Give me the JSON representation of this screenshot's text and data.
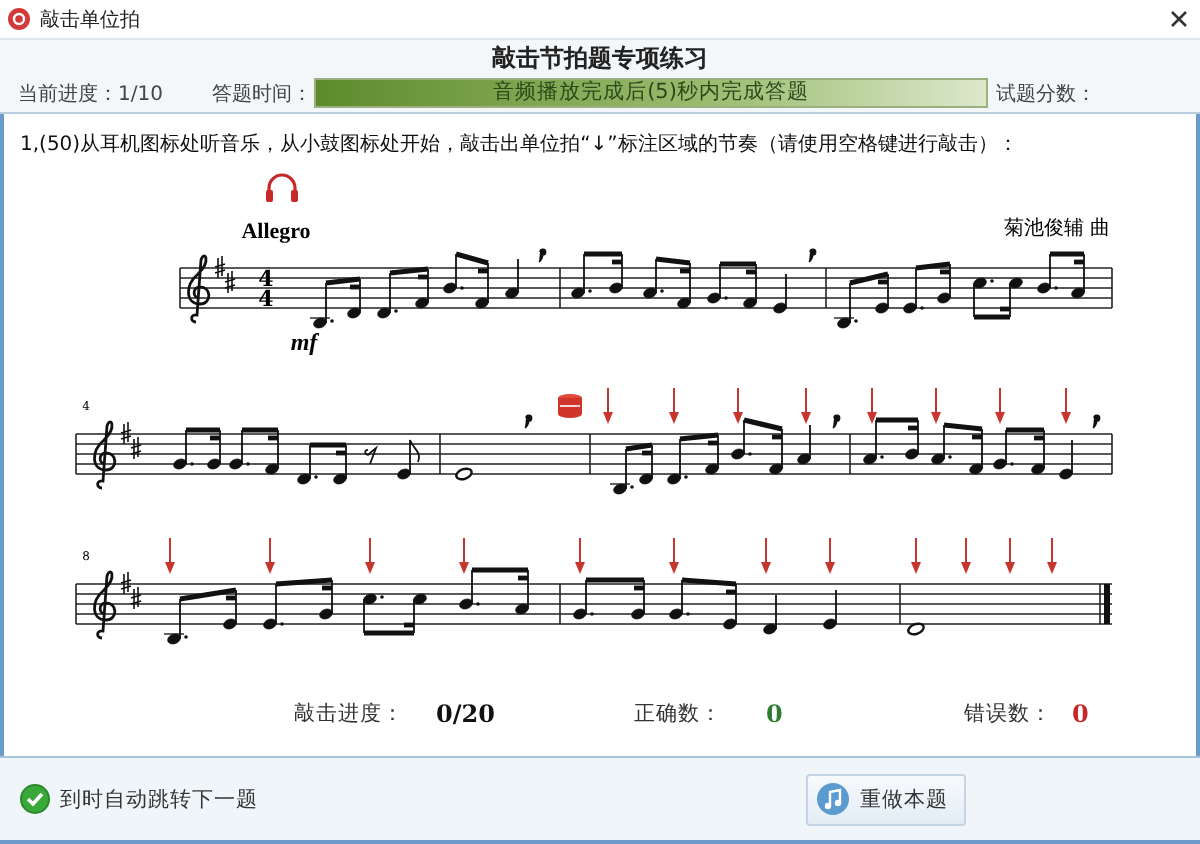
{
  "window": {
    "title": "敲击单位拍"
  },
  "header": {
    "title": "敲击节拍题专项练习",
    "progress": "当前进度：1/10",
    "time_label": "答题时间：",
    "time_bar": {
      "text": "音频播放完成后(5)秒内完成答题",
      "level": 1
    },
    "score_label": "试题分数："
  },
  "question": "1,(50)从耳机图标处听音乐，从小鼓图标处开始，敲击出单位拍“↓”标注区域的节奏（请使用空格键进行敲击）：",
  "score": {
    "tempo": "Allegro",
    "composer": "菊池俊辅 曲",
    "time_signature": [
      "4",
      "4"
    ],
    "dynamic": "mf",
    "measure_numbers": [
      "4",
      "8"
    ]
  },
  "stats": [
    {
      "label": "敲击进度：",
      "value": "0/20",
      "color": "#111111"
    },
    {
      "label": "正确数：",
      "value": "0",
      "color": "#2e7d32"
    },
    {
      "label": "错误数：",
      "value": "0",
      "color": "#c62828"
    }
  ],
  "footer": {
    "auto_next": {
      "label": "到时自动跳转下一题",
      "checked": true
    },
    "redo_button": "重做本题"
  }
}
